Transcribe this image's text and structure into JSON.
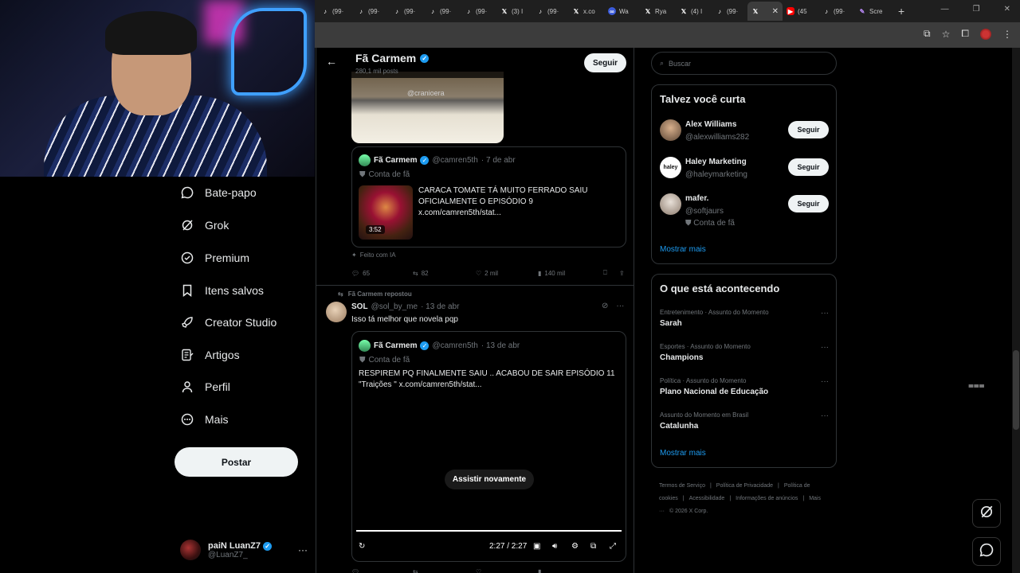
{
  "browser": {
    "tabs": [
      {
        "icon": "tiktok",
        "label": "(99·"
      },
      {
        "icon": "tiktok",
        "label": "(99·"
      },
      {
        "icon": "tiktok",
        "label": "(99·"
      },
      {
        "icon": "tiktok",
        "label": "(99·"
      },
      {
        "icon": "tiktok",
        "label": "(99·"
      },
      {
        "icon": "x",
        "label": "(3) I"
      },
      {
        "icon": "tiktok",
        "label": "(99·"
      },
      {
        "icon": "x",
        "label": "x.co"
      },
      {
        "icon": "docs",
        "label": "Wa"
      },
      {
        "icon": "x",
        "label": "Rya"
      },
      {
        "icon": "x",
        "label": "(4) I"
      },
      {
        "icon": "tiktok",
        "label": "(99·"
      },
      {
        "icon": "x",
        "label": "",
        "active": true
      },
      {
        "icon": "youtube",
        "label": "(45"
      },
      {
        "icon": "tiktok",
        "label": "(99·"
      },
      {
        "icon": "pen",
        "label": "Scre"
      }
    ],
    "new_tab": "+",
    "accent": "#1d9bf0"
  },
  "nav": {
    "items": [
      {
        "label": "Bate-papo",
        "icon": "chat-bubble-icon"
      },
      {
        "label": "Grok",
        "icon": "grok-icon"
      },
      {
        "label": "Premium",
        "icon": "premium-icon"
      },
      {
        "label": "Itens salvos",
        "icon": "bookmark-icon"
      },
      {
        "label": "Creator Studio",
        "icon": "rocket-icon"
      },
      {
        "label": "Artigos",
        "icon": "article-icon"
      },
      {
        "label": "Perfil",
        "icon": "person-icon"
      },
      {
        "label": "Mais",
        "icon": "more-circle-icon"
      }
    ],
    "post_button": "Postar",
    "account": {
      "name": "paiN LuanZ7",
      "handle": "@LuanZ7_"
    }
  },
  "profile_header": {
    "name": "Fã Carmem",
    "posts": "280,1 mil posts",
    "follow": "Seguir"
  },
  "post1": {
    "image_watermark": "@cranioera",
    "quote": {
      "name": "Fã Carmem",
      "handle": "@camren5th",
      "date": "· 7 de abr",
      "label": "Conta de fã",
      "duration": "3:52",
      "text": "CARACA TOMATE TÁ MUITO FERRADO SAIU OFICIALMENTE O EPISÓDIO 9  x.com/camren5th/stat..."
    },
    "ai_label": "Feito com IA",
    "stats": {
      "replies": "65",
      "reposts": "82",
      "likes": "2 mil",
      "views": "140 mil"
    }
  },
  "post2": {
    "repost_label": "Fã Carmem repostou",
    "name": "SOL",
    "handle": "@sol_by_me",
    "date": "· 13 de abr",
    "text": "Isso tá melhor que novela pqp",
    "quote": {
      "name": "Fã Carmem",
      "handle": "@camren5th",
      "date": "· 13 de abr",
      "label": "Conta de fã",
      "text_line1": "RESPIREM PQ FINALMENTE SAIU .. ACABOU DE SAIR EPISÓDIO 11",
      "text_line2": "\"Traições \"  x.com/camren5th/stat..."
    },
    "replay": "Assistir novamente",
    "time": "2:27 / 2:27",
    "progress": 1.0
  },
  "right": {
    "search_placeholder": "Buscar",
    "who_title": "Talvez você curta",
    "who": [
      {
        "name": "Alex Williams",
        "handle": "@alexwilliams282",
        "button": "Seguir"
      },
      {
        "name": "Haley Marketing",
        "handle": "@haleymarketing",
        "button": "Seguir",
        "avatar_text": "haley"
      },
      {
        "name": "mafer.",
        "handle": "@softjaurs",
        "extra": "Conta de fã",
        "button": "Seguir"
      }
    ],
    "who_more": "Mostrar mais",
    "trends_title": "O que está acontecendo",
    "trends": [
      {
        "category": "Entretenimento · Assunto do Momento",
        "title": "Sarah"
      },
      {
        "category": "Esportes · Assunto do Momento",
        "title": "Champions"
      },
      {
        "category": "Política · Assunto do Momento",
        "title": "Plano Nacional de Educação"
      },
      {
        "category": "Assunto do Momento em Brasil",
        "title": "Catalunha"
      }
    ],
    "trends_more": "Mostrar mais",
    "footer": [
      "Termos de Serviço",
      "|",
      "Política de Privacidade",
      "|",
      "Política de cookies",
      "|",
      "Acessibilidade",
      "|",
      "Informações de anúncios",
      "|",
      "Mais ···",
      "© 2026 X Corp."
    ]
  }
}
